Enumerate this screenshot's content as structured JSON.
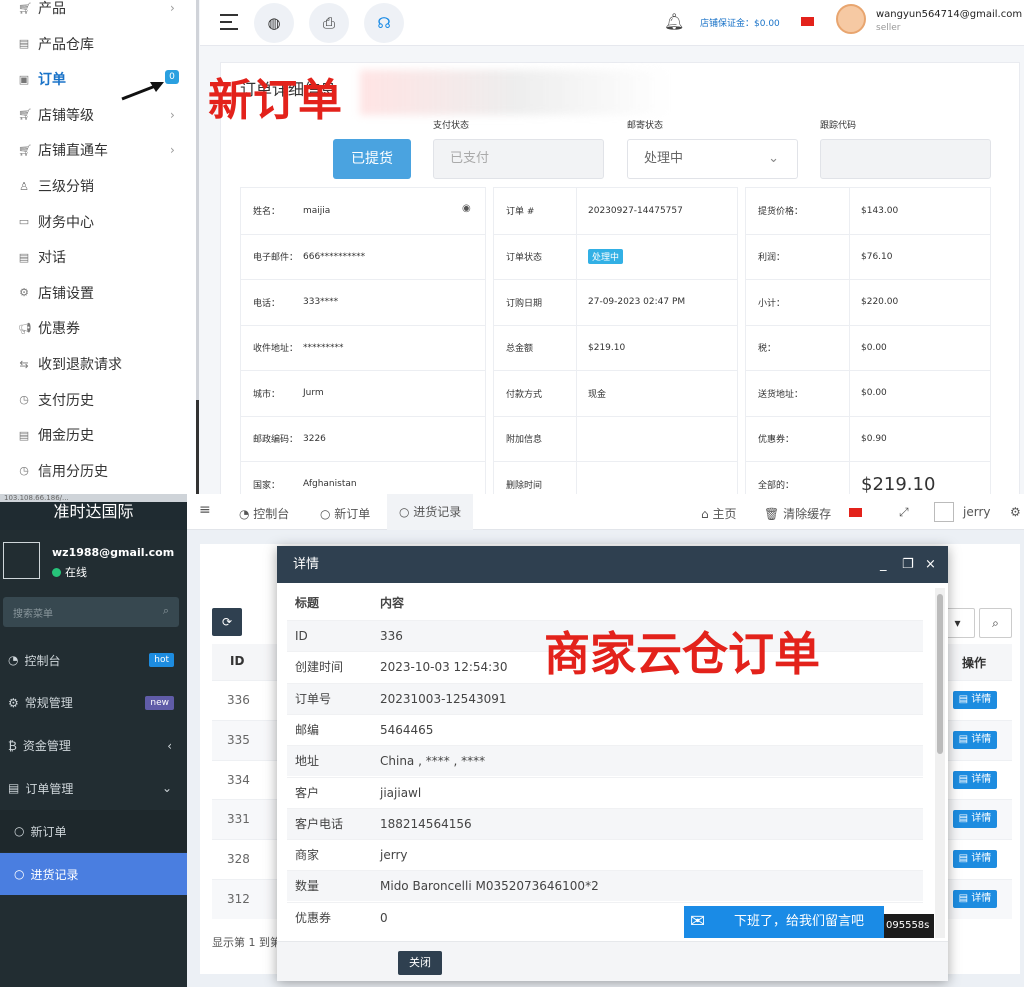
{
  "top": {
    "sidebar": {
      "items": [
        {
          "label": "产品",
          "icon": "cart-icon"
        },
        {
          "label": "产品仓库",
          "icon": "box-icon"
        },
        {
          "label": "订单",
          "icon": "order-icon",
          "badge": "0"
        },
        {
          "label": "店铺等级",
          "icon": "cart-icon"
        },
        {
          "label": "店铺直通车",
          "icon": "cart-icon"
        },
        {
          "label": "三级分销",
          "icon": "user-icon"
        },
        {
          "label": "财务中心",
          "icon": "money-icon"
        },
        {
          "label": "对话",
          "icon": "chat-icon"
        },
        {
          "label": "店铺设置",
          "icon": "gear-icon"
        },
        {
          "label": "优惠券",
          "icon": "megaphone-icon"
        },
        {
          "label": "收到退款请求",
          "icon": "refund-icon"
        },
        {
          "label": "支付历史",
          "icon": "history-icon"
        },
        {
          "label": "佣金历史",
          "icon": "doc-icon"
        },
        {
          "label": "信用分历史",
          "icon": "history-icon"
        }
      ]
    },
    "topbar": {
      "deposit": "店铺保证金：$0.00",
      "email": "wangyun564714@gmail.com",
      "role": "seller"
    },
    "overlay_text": "新订单",
    "card_title": "订单详细信息",
    "fields": {
      "delivered_label": "已提货",
      "pay_status_label": "支付状态",
      "pay_status_value": "已支付",
      "shipping_status_label": "邮寄状态",
      "shipping_status_value": "处理中",
      "tracking_label": "跟踪代码"
    },
    "customer": [
      {
        "k": "姓名：",
        "v": "maijia"
      },
      {
        "k": "电子邮件：",
        "v": "666**********"
      },
      {
        "k": "电话：",
        "v": "333****"
      },
      {
        "k": "收件地址：",
        "v": "*********"
      },
      {
        "k": "城市：",
        "v": "Jurm"
      },
      {
        "k": "邮政编码：",
        "v": "3226"
      },
      {
        "k": "国家：",
        "v": "Afghanistan"
      }
    ],
    "order": [
      {
        "k": "订单 #",
        "v": "20230927-14475757"
      },
      {
        "k": "订单状态",
        "v": "处理中"
      },
      {
        "k": "订购日期",
        "v": "27-09-2023 02:47 PM"
      },
      {
        "k": "总金额",
        "v": "$219.10"
      },
      {
        "k": "付款方式",
        "v": "现金"
      },
      {
        "k": "附加信息",
        "v": ""
      },
      {
        "k": "删除时间",
        "v": ""
      }
    ],
    "price": [
      {
        "k": "提货价格：",
        "v": "$143.00"
      },
      {
        "k": "利润：",
        "v": "$76.10"
      },
      {
        "k": "小计：",
        "v": "$220.00"
      },
      {
        "k": "税：",
        "v": "$0.00"
      },
      {
        "k": "送货地址：",
        "v": "$0.00"
      },
      {
        "k": "优惠券：",
        "v": "$0.90"
      },
      {
        "k": "全部的：",
        "v": "$219.10"
      }
    ]
  },
  "bottom": {
    "url": "103.108.66.186/...",
    "app_title": "准时达国际",
    "user_email": "wz1988@gmail.com",
    "user_status": "在线",
    "search_placeholder": "搜索菜单",
    "menu": [
      {
        "label": "控制台",
        "tag": "hot"
      },
      {
        "label": "常规管理",
        "tag": "new"
      },
      {
        "label": "资金管理",
        "tag": ""
      },
      {
        "label": "订单管理",
        "tag": ""
      },
      {
        "label": "新订单",
        "tag": ""
      },
      {
        "label": "进货记录",
        "tag": ""
      }
    ],
    "tabs": [
      "控制台",
      "新订单",
      "进货记录"
    ],
    "top_right": {
      "home": "主页",
      "clear": "清除缓存",
      "user": "jerry"
    },
    "table": {
      "id_header": "ID",
      "op_header": "操作",
      "ids": [
        "336",
        "335",
        "334",
        "331",
        "328",
        "312"
      ],
      "detail_label": "详情",
      "footer": "显示第 1 到第"
    },
    "overlay_text": "商家云仓订单",
    "modal": {
      "title": "详情",
      "head_k": "标题",
      "head_v": "内容",
      "rows": [
        {
          "k": "ID",
          "v": "336"
        },
        {
          "k": "创建时间",
          "v": "2023-10-03 12:54:30"
        },
        {
          "k": "订单号",
          "v": "20231003-12543091"
        },
        {
          "k": "邮编",
          "v": "5464465"
        },
        {
          "k": "地址",
          "v": "China , **** , ****"
        },
        {
          "k": "客户",
          "v": "jiajiawl"
        },
        {
          "k": "客户电话",
          "v": "188214564156"
        },
        {
          "k": "商家",
          "v": "jerry"
        },
        {
          "k": "数量",
          "v": "Mido Baroncelli M0352073646100*2"
        },
        {
          "k": "优惠券",
          "v": "0"
        }
      ],
      "close_label": "关闭"
    },
    "chat": {
      "label": "下班了，给我们留言吧",
      "code": "095558s"
    }
  }
}
